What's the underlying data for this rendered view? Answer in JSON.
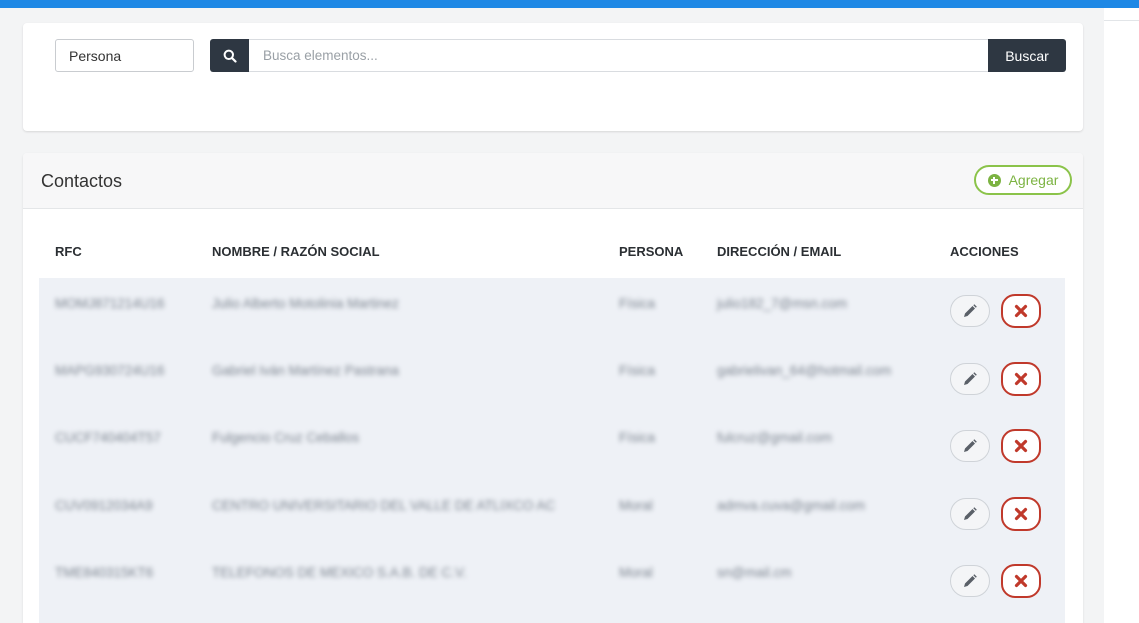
{
  "search": {
    "persona_value": "Persona",
    "placeholder": "Busca elementos...",
    "button_label": "Buscar",
    "icon": "search-icon"
  },
  "contacts": {
    "title": "Contactos",
    "add_label": "Agregar",
    "add_icon": "plus-circle-icon",
    "headers": {
      "rfc": "RFC",
      "nombre": "NOMBRE / RAZÓN SOCIAL",
      "persona": "PERSONA",
      "direccion": "DIRECCIÓN / EMAIL",
      "acciones": "ACCIONES"
    },
    "rows": [
      {
        "rfc": "MOMJ871214U16",
        "nombre": "Julio Alberto Motolinia Martinez",
        "persona": "Física",
        "email": "julio182_7@msn.com"
      },
      {
        "rfc": "MAPG930724U16",
        "nombre": "Gabriel Iván Martínez Pastrana",
        "persona": "Física",
        "email": "gabrielivan_64@hotmail.com"
      },
      {
        "rfc": "CUCF740404T57",
        "nombre": "Fulgencio Cruz Ceballos",
        "persona": "Física",
        "email": "fulcruz@gmail.com"
      },
      {
        "rfc": "CUV0912034A9",
        "nombre": "CENTRO UNIVERSITARIO DEL VALLE DE ATLIXCO AC",
        "persona": "Moral",
        "email": "admva.cuva@gmail.com"
      },
      {
        "rfc": "TME840315KT6",
        "nombre": "TELEFONOS DE MEXICO S.A.B. DE C.V.",
        "persona": "Moral",
        "email": "sn@mail.cm"
      }
    ],
    "edit_icon": "pencil-icon",
    "delete_icon": "close-icon"
  },
  "colors": {
    "topbar": "#1e88e5",
    "dark_button": "#2e3742",
    "add_green": "#7cb342",
    "delete_red": "#c0392b",
    "row_bg": "#eef1f6"
  }
}
